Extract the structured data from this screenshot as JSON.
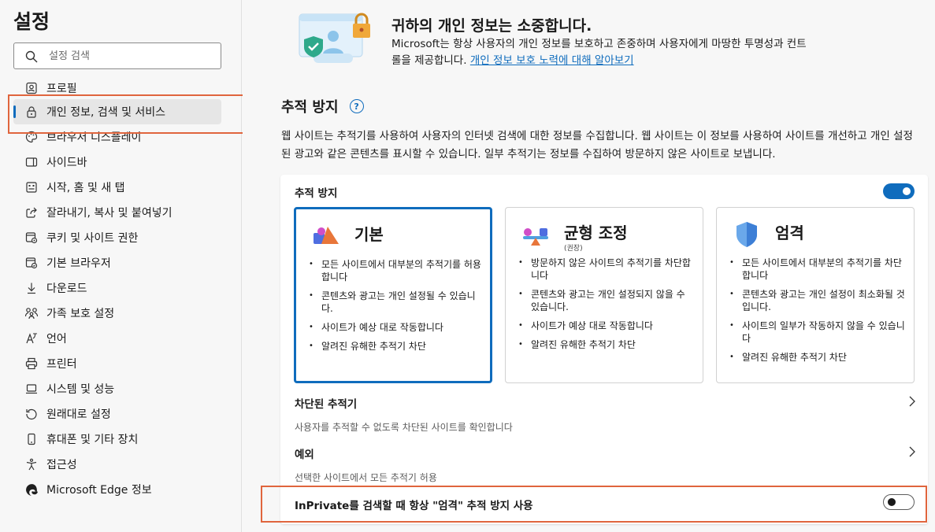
{
  "sidebar": {
    "title": "설정",
    "search_placeholder": "설정 검색",
    "items": [
      {
        "label": "프로필"
      },
      {
        "label": "개인 정보, 검색 및 서비스"
      },
      {
        "label": "브라우저 디스플레이"
      },
      {
        "label": "사이드바"
      },
      {
        "label": "시작, 홈 및 새 탭"
      },
      {
        "label": "잘라내기, 복사 및 붙여넣기"
      },
      {
        "label": "쿠키 및 사이트 권한"
      },
      {
        "label": "기본 브라우저"
      },
      {
        "label": "다운로드"
      },
      {
        "label": "가족 보호 설정"
      },
      {
        "label": "언어"
      },
      {
        "label": "프린터"
      },
      {
        "label": "시스템 및 성능"
      },
      {
        "label": "원래대로 설정"
      },
      {
        "label": "휴대폰 및 기타 장치"
      },
      {
        "label": "접근성"
      },
      {
        "label": "Microsoft Edge 정보"
      }
    ],
    "active_index": 1
  },
  "hero": {
    "title": "귀하의 개인 정보는 소중합니다.",
    "desc": "Microsoft는 항상 사용자의 개인 정보를 보호하고 존중하며 사용자에게 마땅한 투명성과 컨트롤을 제공합니다. ",
    "link": "개인 정보 보호 노력에 대해 알아보기"
  },
  "tracking": {
    "title": "추적 방지",
    "desc": "웹 사이트는 추적기를 사용하여 사용자의 인터넷 검색에 대한 정보를 수집합니다. 웹 사이트는 이 정보를 사용하여 사이트를 개선하고 개인 설정된 광고와 같은 콘텐츠를 표시할 수 있습니다. 일부 추적기는 정보를 수집하여 방문하지 않은 사이트로 보냅니다.",
    "toggle_label": "추적 방지",
    "toggle_on": true,
    "levels": [
      {
        "name": "기본",
        "sub": "",
        "selected": true,
        "bullets": [
          "모든 사이트에서 대부분의 추적기를 허용합니다",
          "콘텐츠와 광고는 개인 설정될 수 있습니다.",
          "사이트가 예상 대로 작동합니다",
          "알려진 유해한 추적기 차단"
        ]
      },
      {
        "name": "균형 조정",
        "sub": "(권장)",
        "selected": false,
        "bullets": [
          "방문하지 않은 사이트의 추적기를 차단합니다",
          "콘텐츠와 광고는 개인 설정되지 않을 수 있습니다.",
          "사이트가 예상 대로 작동합니다",
          "알려진 유해한 추적기 차단"
        ]
      },
      {
        "name": "엄격",
        "sub": "",
        "selected": false,
        "bullets": [
          "모든 사이트에서 대부분의 추적기를 차단합니다",
          "콘텐츠와 광고는 개인 설정이 최소화될 것입니다.",
          "사이트의 일부가 작동하지 않을 수 있습니다",
          "알려진 유해한 추적기 차단"
        ]
      }
    ],
    "blocked": {
      "title": "차단된 추적기",
      "desc": "사용자를 추적할 수 없도록 차단된 사이트를 확인합니다"
    },
    "exceptions": {
      "title": "예외",
      "desc": "선택한 사이트에서 모든 추적기 허용"
    },
    "inprivate": {
      "label": "InPrivate를 검색할 때 항상 \"엄격\" 추적 방지 사용",
      "toggle_on": false
    }
  },
  "colors": {
    "accent": "#0f6cbd",
    "highlight": "#e0653d"
  }
}
